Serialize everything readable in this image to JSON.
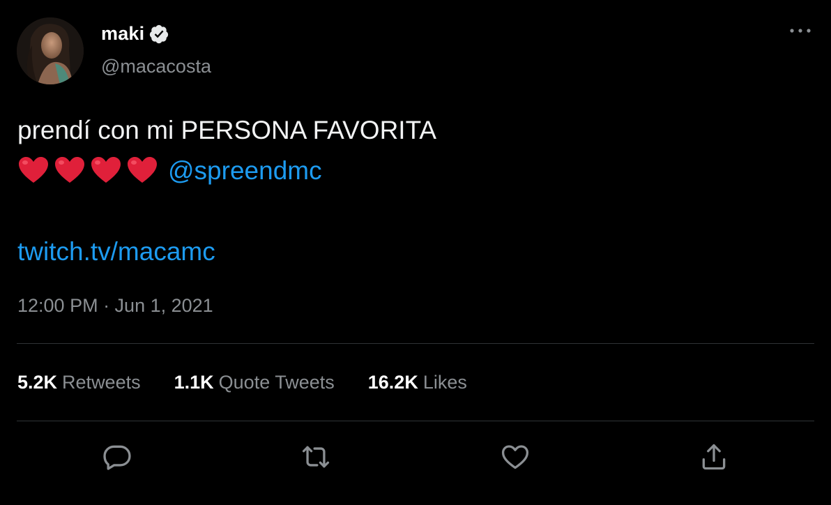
{
  "author": {
    "display_name": "maki",
    "handle": "@macacosta",
    "avatar_icon": "profile-photo"
  },
  "tweet": {
    "line1": "prendí con mi PERSONA FAVORITA",
    "hearts": "❤️❤️❤️❤️",
    "mention": "@spreendmc",
    "link": "twitch.tv/macamc",
    "timestamp": "12:00 PM · Jun 1, 2021"
  },
  "stats": {
    "retweets_value": "5.2K",
    "retweets_label": "Retweets",
    "quotes_value": "1.1K",
    "quotes_label": "Quote Tweets",
    "likes_value": "16.2K",
    "likes_label": "Likes"
  },
  "actions": [
    "reply-icon",
    "retweet-icon",
    "like-icon",
    "share-icon"
  ],
  "colors": {
    "background": "#000000",
    "primary_text": "#e7e9ea",
    "secondary_text": "#8b8f93",
    "link": "#1d9bf0",
    "divider": "#2f3336",
    "heart": "#e0203a"
  }
}
